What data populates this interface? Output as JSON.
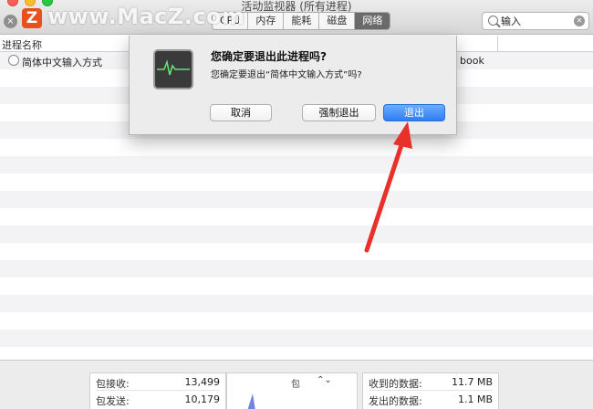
{
  "window": {
    "title": "活动监视器 (所有进程)"
  },
  "watermark": {
    "logo_letter": "Z",
    "text": "www.MacZ.com"
  },
  "toolbar": {
    "close_process_glyph": "×",
    "tabs": [
      {
        "label": "CPU",
        "active": false
      },
      {
        "label": "内存",
        "active": false
      },
      {
        "label": "能耗",
        "active": false
      },
      {
        "label": "磁盘",
        "active": false
      },
      {
        "label": "网络",
        "active": true
      }
    ],
    "search": {
      "value": "输入"
    }
  },
  "table": {
    "columns": [
      "进程名称"
    ],
    "rows": [
      {
        "name": "简体中文输入方式",
        "user": "book"
      }
    ]
  },
  "dialog": {
    "title": "您确定要退出此进程吗?",
    "message": "您确定要退出“简体中文输入方式”吗?",
    "buttons": {
      "cancel": "取消",
      "force_quit": "强制退出",
      "quit": "退出"
    }
  },
  "stats": {
    "left": [
      {
        "label": "包接收:",
        "value": "13,499"
      },
      {
        "label": "包发送:",
        "value": "10,179"
      }
    ],
    "graph_selector": "包",
    "right": [
      {
        "label": "收到的数据:",
        "value": "11.7 MB"
      },
      {
        "label": "发出的数据:",
        "value": "1.1 MB"
      }
    ]
  },
  "colors": {
    "accent_blue": "#2f7df2",
    "annotation_arrow": "#e8312a",
    "logo_orange": "#e8501c"
  }
}
